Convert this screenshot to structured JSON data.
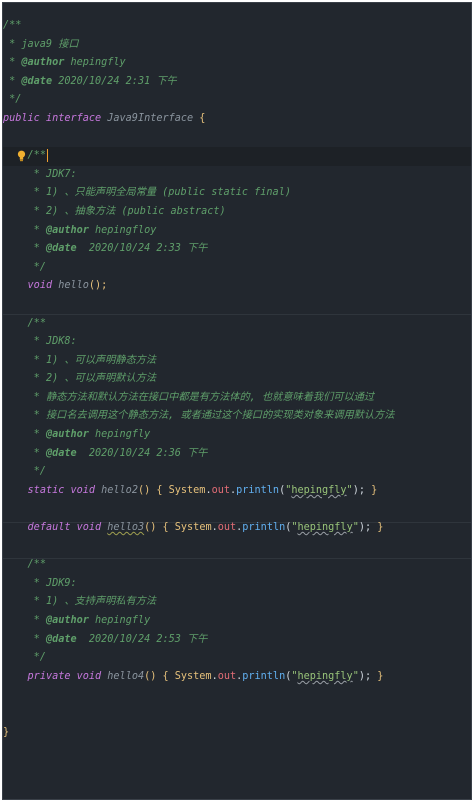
{
  "code": {
    "header_open": "/**",
    "header_l1": " * java9 接口",
    "header_author_tag": "@author",
    "header_author_val": " hepingfly",
    "header_date_tag": "@date",
    "header_date_val": " 2020/10/24 2:31 下午",
    "header_close": " */",
    "interface_kw": "public interface",
    "interface_name": " Java9Interface",
    "open_brace": "{",
    "jdk7_open": "/**",
    "jdk7_title": "* JDK7:",
    "jdk7_1": "* 1) 、只能声明全局常量 (public static final)",
    "jdk7_2": "* 2) 、抽象方法 (public abstract)",
    "jdk7_author_val": " hepingfloy",
    "jdk7_date_val": "  2020/10/24 2:33 下午",
    "close_comment": "*/",
    "hello_kw": "void",
    "hello_name": " hello",
    "hello_rest": "();",
    "jdk8_open": "/**",
    "jdk8_title": "* JDK8:",
    "jdk8_1": "* 1) 、可以声明静态方法",
    "jdk8_2": "* 2) 、可以声明默认方法",
    "jdk8_3": "* 静态方法和默认方法在接口中都是有方法体的, 也就意味着我们可以通过",
    "jdk8_4": "* 接口名去调用这个静态方法, 或者通过这个接口的实现类对象来调用默认方法",
    "jdk8_author_val": " hepingfly",
    "jdk8_date_val": "  2020/10/24 2:36 下午",
    "hello2_kw": "static void",
    "hello2_name": " hello2",
    "hello3_kw": "default void",
    "hello3_name": "hello3",
    "jdk9_open": "/**",
    "jdk9_title": "* JDK9:",
    "jdk9_1": "* 1) 、支持声明私有方法",
    "jdk9_author_val": " hepingfly",
    "jdk9_date_val": "  2020/10/24 2:53 下午",
    "hello4_kw": "private void",
    "hello4_name": " hello4",
    "sys": "System",
    "out": "out",
    "println": "println",
    "str_val": "hepingfly",
    "author_tag": "@author",
    "date_tag": "@date",
    "close_brace": "}"
  },
  "colors": {
    "background": "#22272e",
    "comment": "#5f9f6a",
    "keyword": "#c678dd",
    "type": "#e5c07b",
    "field": "#e06c75",
    "method": "#61afef",
    "string": "#98c379"
  },
  "icons": {
    "gutter": "lightbulb-icon"
  }
}
